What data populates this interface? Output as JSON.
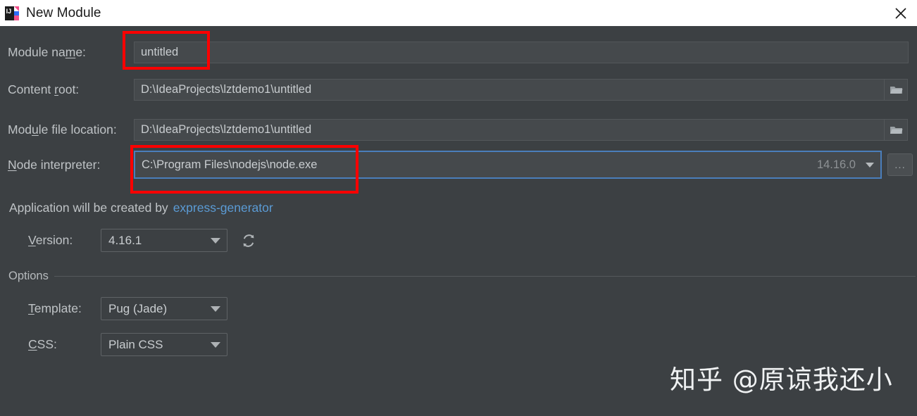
{
  "window": {
    "title": "New Module",
    "app_icon": "intellij-idea-icon",
    "close_icon": "close-icon",
    "background_color": "#3c4043",
    "titlebar_color": "#ffffff"
  },
  "form": {
    "module_name": {
      "label_before": "Module na",
      "label_mnemonic": "m",
      "label_after": "e:",
      "value": "untitled",
      "placeholder": "untitled"
    },
    "content_root": {
      "label_before": "Content ",
      "label_mnemonic": "r",
      "label_after": "oot:",
      "value": "D:\\IdeaProjects\\lztdemo1\\untitled",
      "placeholder": "Select content root",
      "browse_icon": "folder-icon"
    },
    "module_file_location": {
      "label_before": "Mod",
      "label_mnemonic": "u",
      "label_after": "le file location:",
      "value": "D:\\IdeaProjects\\lztdemo1\\untitled",
      "placeholder": "Select module file location",
      "browse_icon": "folder-icon"
    },
    "node_interpreter": {
      "label_before": "",
      "label_mnemonic": "N",
      "label_after": "ode interpreter:",
      "value": "C:\\Program Files\\nodejs\\node.exe",
      "placeholder": "Select Node.js interpreter",
      "node_version": "14.16.0",
      "dropdown_icon": "chevron-down-icon",
      "more_button_label": "...",
      "focus_color": "#4a7ebb"
    }
  },
  "generator": {
    "hint_text": "Application will be created by",
    "link_text": "express-generator",
    "link_color": "#5b9bd5"
  },
  "version": {
    "label_before": "",
    "label_mnemonic": "V",
    "label_after": "ersion:",
    "value": "4.16.1",
    "dropdown_icon": "chevron-down-icon",
    "refresh_icon": "refresh-icon"
  },
  "options": {
    "section_title": "Options",
    "template": {
      "label_before": "",
      "label_mnemonic": "T",
      "label_after": "emplate:",
      "value": "Pug (Jade)",
      "dropdown_icon": "chevron-down-icon"
    },
    "css": {
      "label_before": "",
      "label_mnemonic": "C",
      "label_after": "SS:",
      "value": "Plain CSS",
      "dropdown_icon": "chevron-down-icon"
    }
  },
  "annotations": {
    "highlight_color": "#fe0000",
    "boxes": [
      {
        "name": "module-name-highlight"
      },
      {
        "name": "node-interpreter-highlight"
      }
    ]
  },
  "watermark": {
    "text": "知乎 @原谅我还小"
  }
}
